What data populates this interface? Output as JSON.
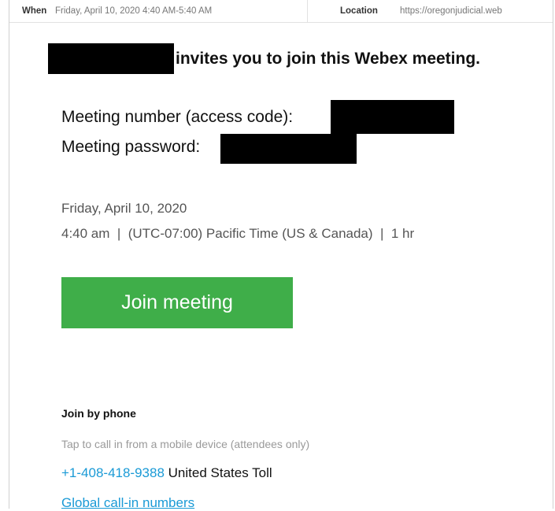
{
  "header": {
    "when_label": "When",
    "when_value": "Friday, April 10, 2020 4:40 AM-5:40 AM",
    "location_label": "Location",
    "location_value": "https://oregonjudicial.web"
  },
  "invite": {
    "text": "invites you to join this Webex meeting."
  },
  "meeting": {
    "number_label": "Meeting number (access code):",
    "password_label": "Meeting password:",
    "date": "Friday, April 10, 2020",
    "time_line": "4:40 am  |  (UTC-07:00) Pacific Time (US & Canada)  |  1 hr"
  },
  "join": {
    "button_label": "Join meeting",
    "color": "#3fae49"
  },
  "phone": {
    "heading": "Join by phone",
    "tap_text": "Tap to call in from a mobile device (attendees only)",
    "number": "+1-408-418-9388",
    "number_label": "United States Toll",
    "global_link": "Global call-in numbers",
    "link_color": "#1a9ad6"
  }
}
